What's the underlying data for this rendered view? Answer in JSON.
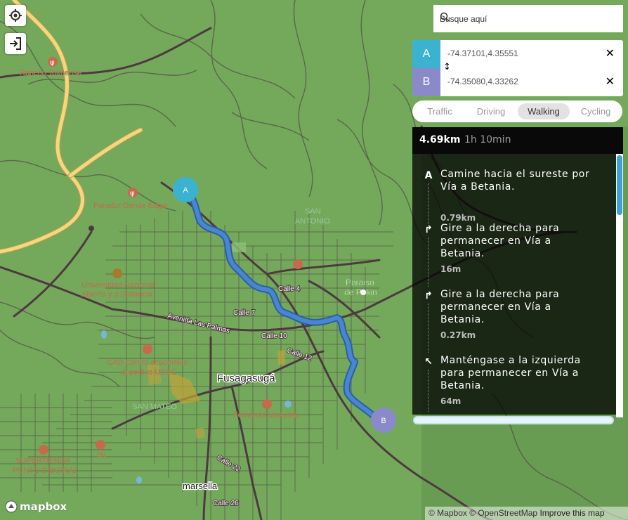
{
  "map": {
    "labels": {
      "rancho": "Rancho Tolmense",
      "parador": "Parador Donde Edgar",
      "universidad1": "Universidad Nacional",
      "universidad2": "Abierta y a Distancia",
      "avenida": "Avenida Las Palmas",
      "calle7": "Calle 7",
      "calle4": "Calle 4",
      "calle10": "Calle 10",
      "calle12": "Calle 12",
      "calle22": "Calle 22",
      "calle26": "Calle 26",
      "san_antonio1": "SAN",
      "san_antonio2": "ANTONIO",
      "paraiso1": "Paraiso",
      "paraiso2": "de Pekin",
      "cad1": "CAD Centro academico",
      "cad2": "deportivo UDEC",
      "fusagasuga": "Fusagasugá",
      "san_mateo": "SAN MATEO",
      "fernando": "Fernando Mazuera",
      "supertienda1": "SUPERTIENDA",
      "supertienda2": "PUNTO CENTRAL",
      "marsella": "marsella",
      "d1": "D1"
    },
    "marker_a": "A",
    "marker_b": "B",
    "colors": {
      "land": "#74a95c",
      "route": "#3c78c5",
      "highway": "#f5d77e",
      "road": "#4d3a3f",
      "marker_a": "#3bb2d0",
      "marker_b": "#8a8acb"
    }
  },
  "controls": {
    "geolocate_icon": "crosshair-icon",
    "login_icon": "sign-in-icon"
  },
  "directions": {
    "search": {
      "placeholder": "Busque aquí",
      "icon": "search-icon"
    },
    "origin": {
      "label": "A",
      "value": "-74.37101,4.35551"
    },
    "destination": {
      "label": "B",
      "value": "-74.35080,4.33262"
    },
    "reverse_icon": "swap-vertical-icon",
    "clear_icon": "close-icon",
    "profiles": [
      "Traffic",
      "Driving",
      "Walking",
      "Cycling"
    ],
    "active_profile": "Walking",
    "summary": {
      "distance": "4.69km",
      "duration": "1h 10min"
    },
    "steps": [
      {
        "icon": "depart-icon",
        "glyph": "A",
        "text": "Camine hacia el sureste por Vía a Betania.",
        "distance": "0.79km"
      },
      {
        "icon": "turn-right-icon",
        "glyph": "↱",
        "text": "Gire a la derecha para permanecer en Vía a Betania.",
        "distance": "16m"
      },
      {
        "icon": "turn-right-icon",
        "glyph": "↱",
        "text": "Gire a la derecha para permanecer en Vía a Betania.",
        "distance": "0.27km"
      },
      {
        "icon": "keep-left-icon",
        "glyph": "↖",
        "text": "Manténgase a la izquierda para permanecer en Vía a Betania.",
        "distance": "64m"
      }
    ]
  },
  "attribution": {
    "mapbox": "© Mapbox",
    "osm": "© OpenStreetMap",
    "improve": "Improve this map",
    "logo": "mapbox"
  }
}
